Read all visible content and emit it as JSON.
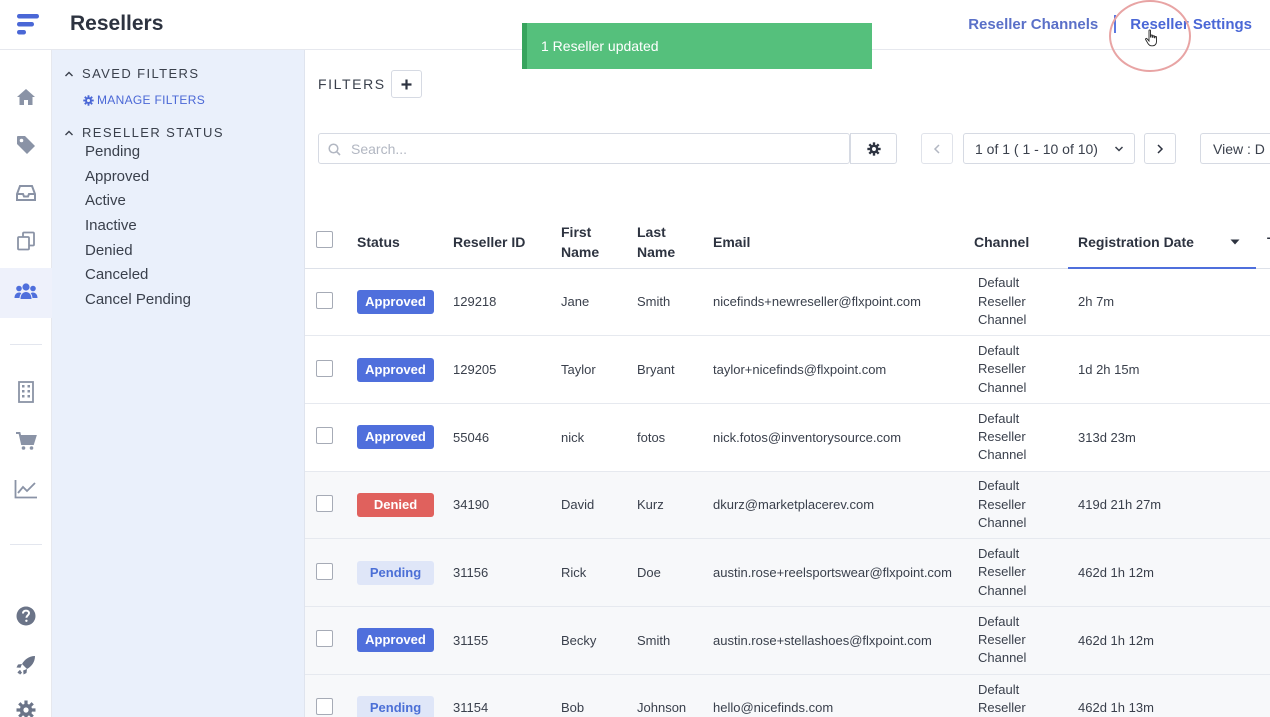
{
  "header": {
    "title": "Resellers",
    "links": [
      "Reseller Channels",
      "Reseller Settings"
    ]
  },
  "toast": {
    "message": "1 Reseller updated"
  },
  "sidebar": {
    "saved_filters_label": "SAVED FILTERS",
    "manage_filters_label": "MANAGE FILTERS",
    "status_label": "RESELLER STATUS",
    "statuses": [
      "Pending",
      "Approved",
      "Active",
      "Inactive",
      "Denied",
      "Canceled",
      "Cancel Pending"
    ]
  },
  "rail_icons": [
    "home-icon",
    "tag-icon",
    "inbox-icon",
    "copy-icon",
    "users-icon",
    "building-icon",
    "cart-icon",
    "chart-icon",
    "help-icon",
    "rocket-icon",
    "settings-icon"
  ],
  "toolbar": {
    "filters_label": "FILTERS",
    "search_placeholder": "Search...",
    "pagination": "1 of 1 ( 1 - 10 of 10)",
    "view_label": "View : D"
  },
  "table": {
    "columns": [
      "Status",
      "Reseller ID",
      "First Name",
      "Last Name",
      "Email",
      "Channel",
      "Registration Date",
      "To"
    ],
    "rows": [
      {
        "status": "Approved",
        "status_type": "approved",
        "id": "129218",
        "first": "Jane",
        "last": "Smith",
        "email": "nicefinds+newreseller@flxpoint.com",
        "channel": "Default Reseller Channel",
        "reg": "2h 7m"
      },
      {
        "status": "Approved",
        "status_type": "approved",
        "id": "129205",
        "first": "Taylor",
        "last": "Bryant",
        "email": "taylor+nicefinds@flxpoint.com",
        "channel": "Default Reseller Channel",
        "reg": "1d 2h 15m"
      },
      {
        "status": "Approved",
        "status_type": "approved",
        "id": "55046",
        "first": "nick",
        "last": "fotos",
        "email": "nick.fotos@inventorysource.com",
        "channel": "Default Reseller Channel",
        "reg": "313d 23m"
      },
      {
        "status": "Denied",
        "status_type": "denied",
        "id": "34190",
        "first": "David",
        "last": "Kurz",
        "email": "dkurz@marketplacerev.com",
        "channel": "Default Reseller Channel",
        "reg": "419d 21h 27m"
      },
      {
        "status": "Pending",
        "status_type": "pending",
        "id": "31156",
        "first": "Rick",
        "last": "Doe",
        "email": "austin.rose+reelsportswear@flxpoint.com",
        "channel": "Default Reseller Channel",
        "reg": "462d 1h 12m"
      },
      {
        "status": "Approved",
        "status_type": "approved",
        "id": "31155",
        "first": "Becky",
        "last": "Smith",
        "email": "austin.rose+stellashoes@flxpoint.com",
        "channel": "Default Reseller Channel",
        "reg": "462d 1h 12m"
      },
      {
        "status": "Pending",
        "status_type": "pending",
        "id": "31154",
        "first": "Bob",
        "last": "Johnson",
        "email": "hello@nicefinds.com",
        "channel": "Default Reseller Channel",
        "reg": "462d 1h 13m"
      }
    ]
  },
  "colors": {
    "accent": "#4f6fdc",
    "toast": "#55c07c",
    "denied": "#e0615d",
    "pending_bg": "#dfe6f8",
    "sidebar_bg": "#eaf0fb"
  }
}
